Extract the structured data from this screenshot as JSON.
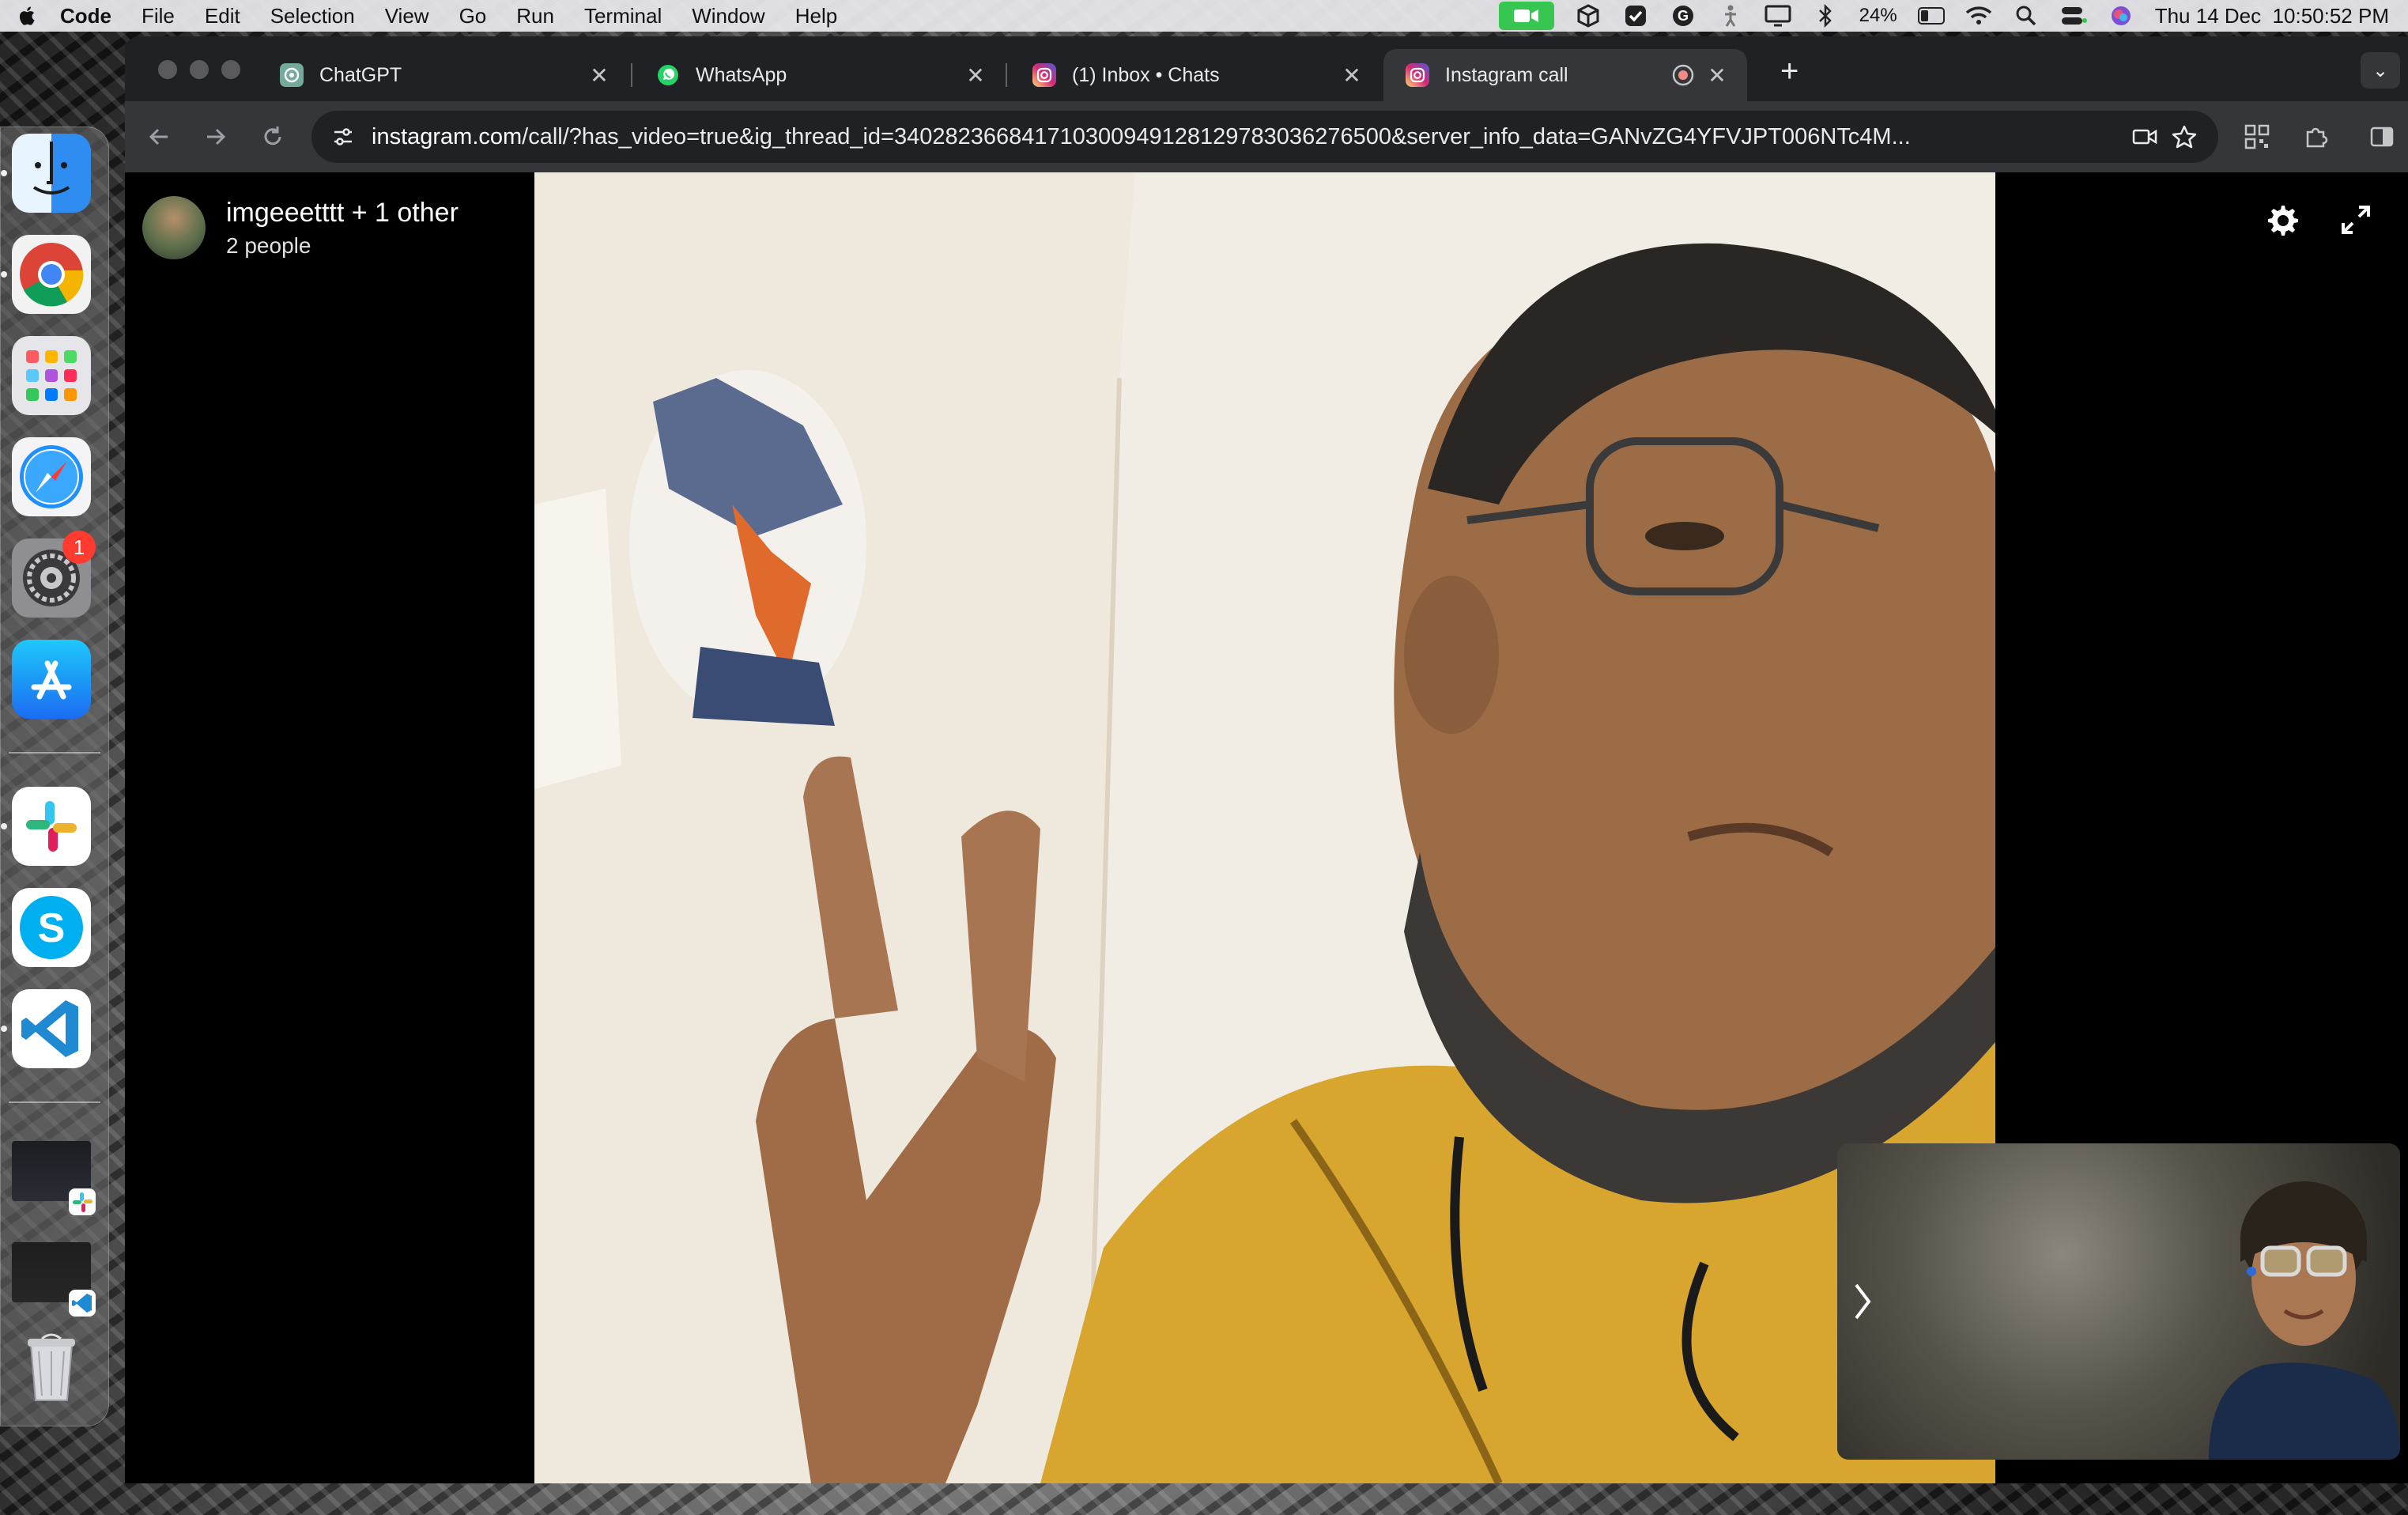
{
  "menubar": {
    "app_name": "Code",
    "items": [
      "File",
      "Edit",
      "Selection",
      "View",
      "Go",
      "Run",
      "Terminal",
      "Window",
      "Help"
    ],
    "battery": "24%",
    "battery_level": 0.24,
    "datetime": "Thu 14 Dec  10:50:52 PM"
  },
  "dock": {
    "apps": [
      "finder",
      "chrome",
      "launchpad",
      "safari",
      "system-settings",
      "app-store",
      "slack",
      "skype",
      "vscode"
    ],
    "settings_badge": "1"
  },
  "browser": {
    "tabs": [
      {
        "title": "ChatGPT",
        "icon": "chatgpt-icon",
        "color": "#74aa9c"
      },
      {
        "title": "WhatsApp",
        "icon": "whatsapp-icon",
        "color": "#25d366"
      },
      {
        "title": "(1) Inbox • Chats",
        "icon": "instagram-icon",
        "color": "#e1306c"
      },
      {
        "title": "Instagram call",
        "icon": "instagram-icon",
        "color": "#e1306c",
        "active": true
      }
    ],
    "url_host": "instagram.com",
    "url_rest": "/call/?has_video=true&ig_thread_id=340282366841710300949128129783036276500&server_info_data=GANvZG4YFVJPT006NTc4M..."
  },
  "call": {
    "title": "imgeeetttt + 1 other",
    "participants": "2 people"
  },
  "colors": {
    "instagram": "#e1306c",
    "hoodie": "#d8a62e",
    "facetime_green": "#37c750"
  }
}
